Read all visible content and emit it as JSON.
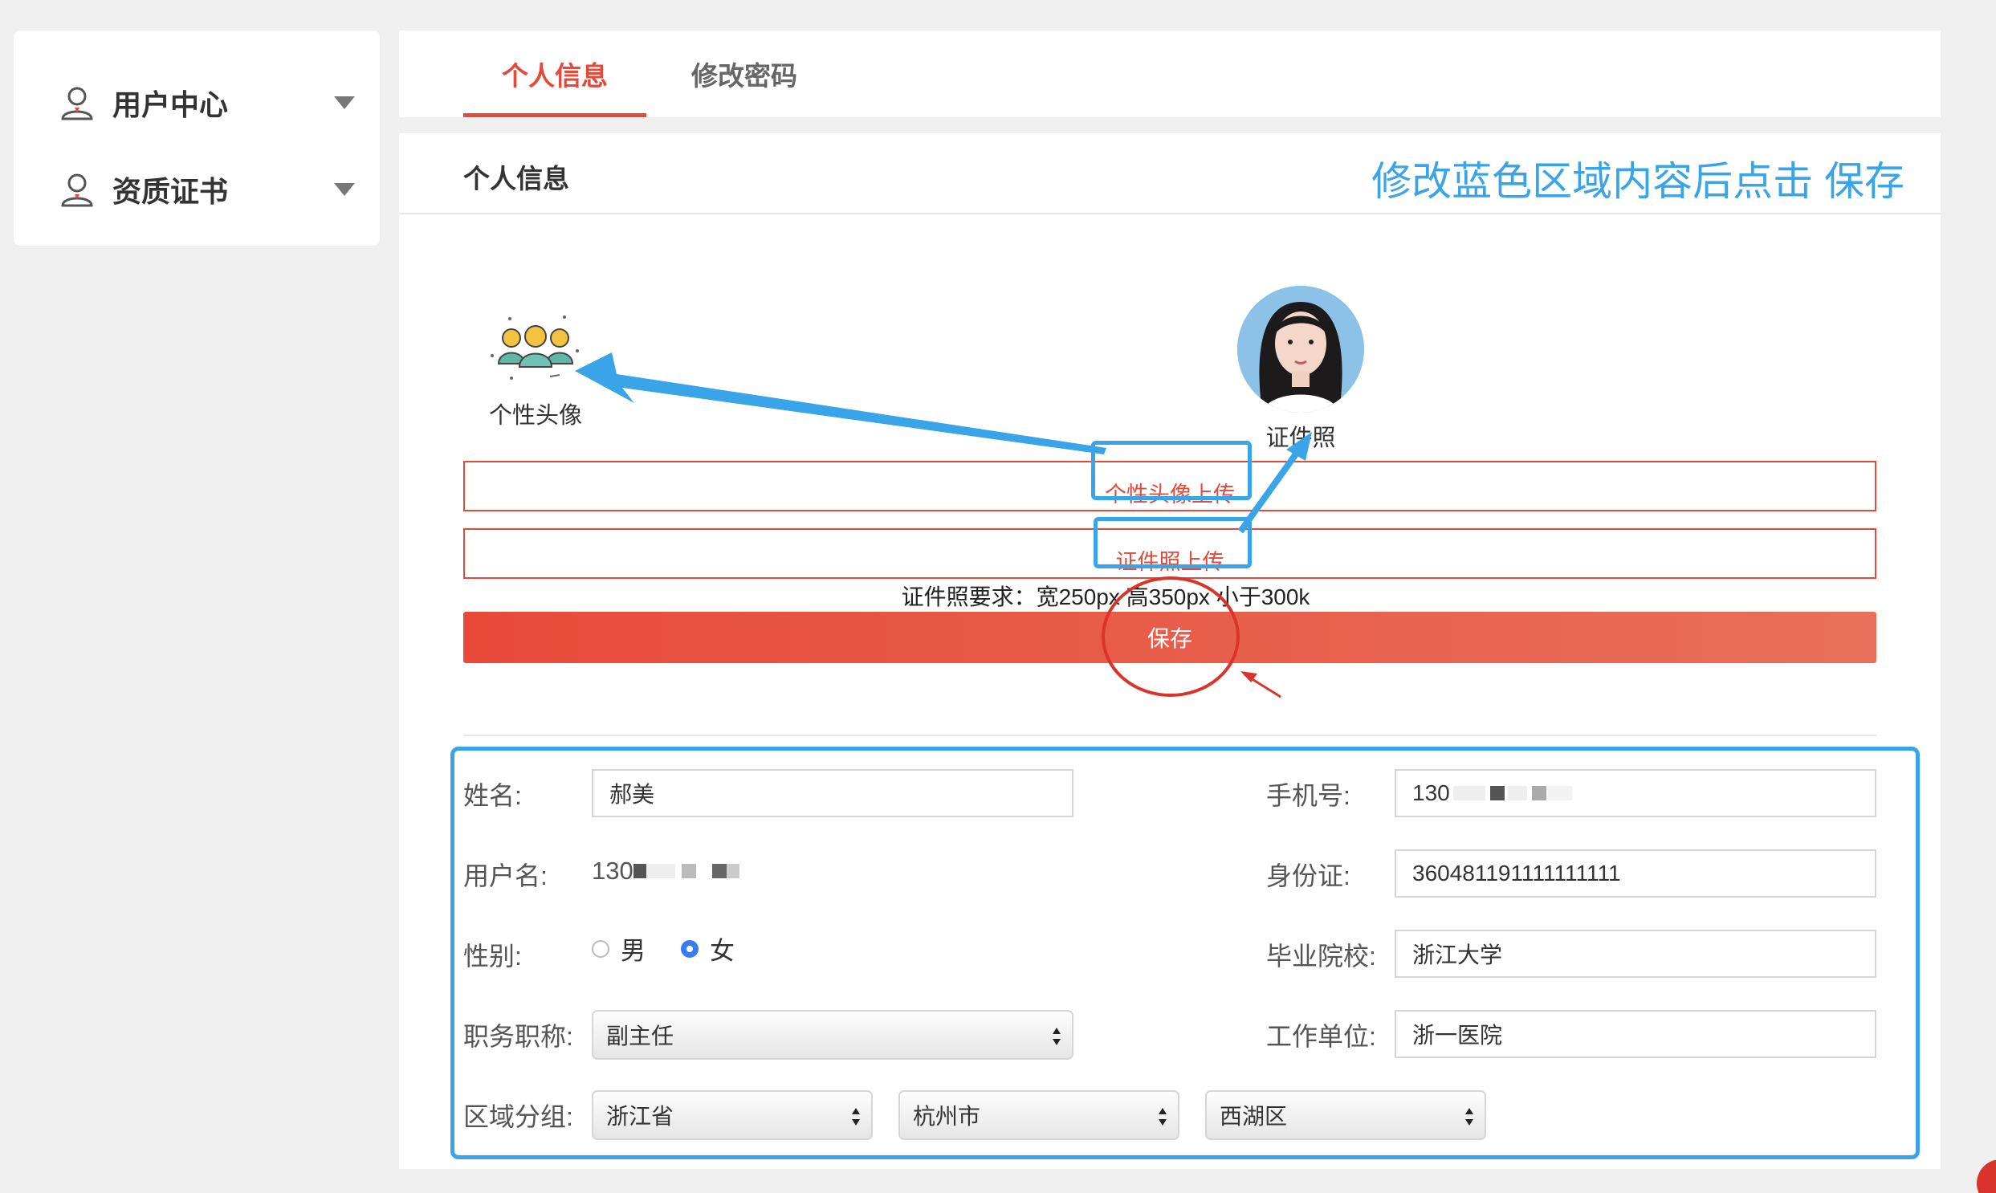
{
  "sidebar": {
    "items": [
      {
        "label": "用户中心",
        "icon": "user-icon"
      },
      {
        "label": "资质证书",
        "icon": "user-icon"
      }
    ]
  },
  "tabs": [
    {
      "label": "个人信息",
      "active": true
    },
    {
      "label": "修改密码",
      "active": false
    }
  ],
  "section": {
    "title": "个人信息",
    "instruction": "修改蓝色区域内容后点击 保存"
  },
  "avatars": {
    "personal_caption": "个性头像",
    "id_caption": "证件照"
  },
  "uploads": {
    "avatar_label": "个性头像上传",
    "id_label": "证件照上传",
    "requirement": "证件照要求：宽250px 高350px 小于300k"
  },
  "save_label": "保存",
  "form": {
    "name_label": "姓名:",
    "name_value": "郝美",
    "phone_label": "手机号:",
    "phone_value": "130",
    "username_label": "用户名:",
    "username_value": "130",
    "id_label": "身份证:",
    "id_value": "360481191111111111",
    "gender_label": "性别:",
    "gender_options": [
      "男",
      "女"
    ],
    "gender_selected": "女",
    "school_label": "毕业院校:",
    "school_value": "浙江大学",
    "title_label": "职务职称:",
    "title_value": "副主任",
    "workplace_label": "工作单位:",
    "workplace_value": "浙一医院",
    "region_label": "区域分组:",
    "province": "浙江省",
    "city": "杭州市",
    "district": "西湖区"
  },
  "colors": {
    "accent_red": "#e24b3b",
    "annotation_blue": "#3aa4e8",
    "radio_blue": "#3a7bf0"
  }
}
